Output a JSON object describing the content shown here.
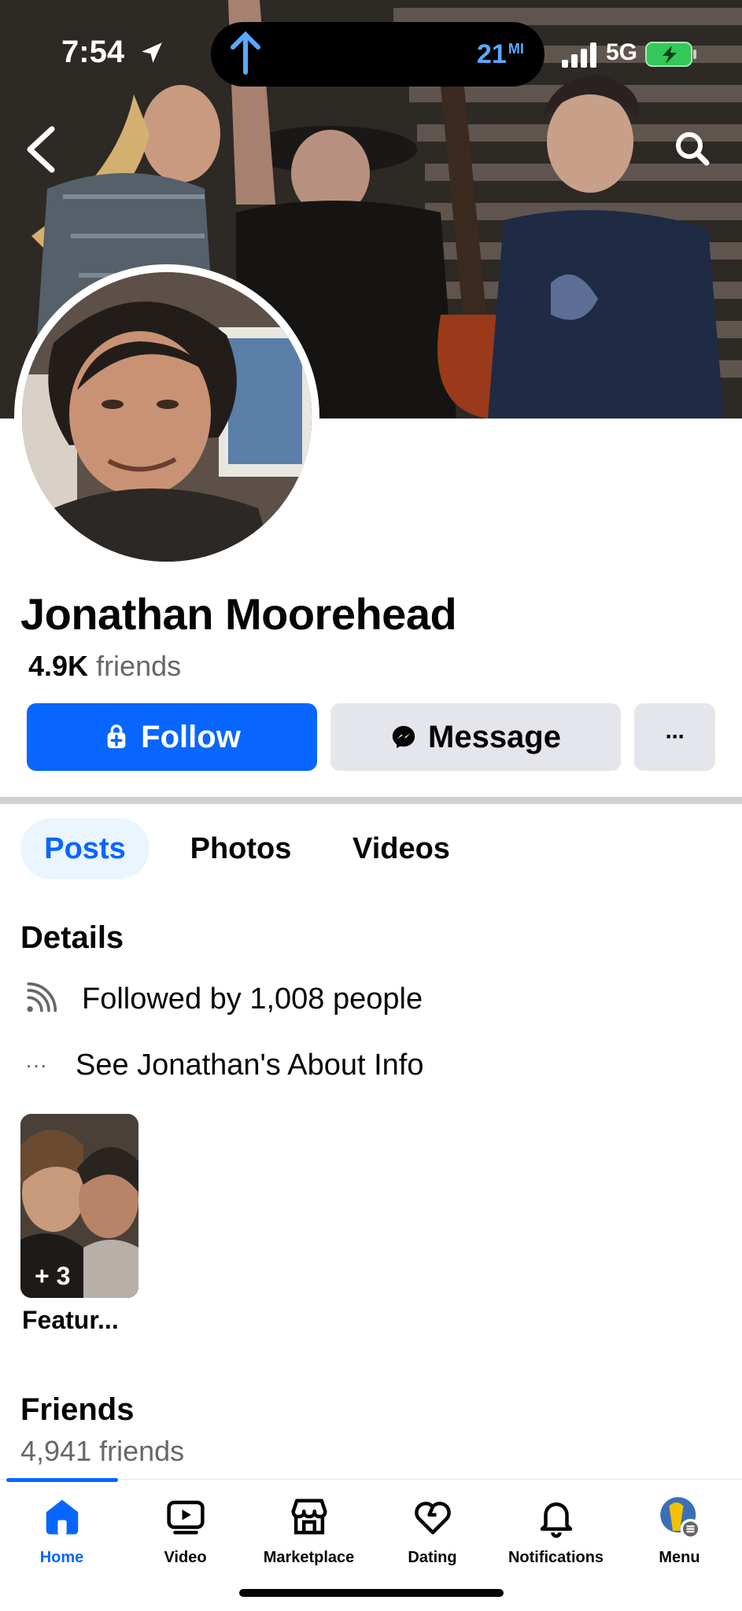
{
  "status_bar": {
    "time": "7:54",
    "navigation_distance": "21",
    "distance_unit": "MI",
    "network": "5G",
    "icons": [
      "location-arrow-icon",
      "navigation-up-arrow-icon",
      "signal-bars-icon",
      "battery-charging-icon"
    ]
  },
  "cover": {
    "back_icon": "chevron-left-icon",
    "search_icon": "search-icon"
  },
  "profile": {
    "name": "Jonathan Moorehead",
    "friends_short": "4.9K",
    "friends_word": "friends"
  },
  "actions": {
    "follow_label": "Follow",
    "message_label": "Message",
    "more_label": "···",
    "accent_color": "#0866ff"
  },
  "tabs": [
    {
      "label": "Posts",
      "active": true
    },
    {
      "label": "Photos",
      "active": false
    },
    {
      "label": "Videos",
      "active": false
    }
  ],
  "details": {
    "title": "Details",
    "followed_by": "Followed by 1,008 people",
    "about_info": "See Jonathan's About Info",
    "more_dots": "···"
  },
  "featured": {
    "count": "+ 3",
    "label": "Featur..."
  },
  "friends_section": {
    "title": "Friends",
    "count": "4,941 friends"
  },
  "bottom_nav": [
    {
      "label": "Home",
      "icon": "home-icon",
      "active": true
    },
    {
      "label": "Video",
      "icon": "video-icon",
      "active": false
    },
    {
      "label": "Marketplace",
      "icon": "marketplace-icon",
      "active": false
    },
    {
      "label": "Dating",
      "icon": "dating-icon",
      "active": false
    },
    {
      "label": "Notifications",
      "icon": "bell-icon",
      "active": false
    },
    {
      "label": "Menu",
      "icon": "menu-avatar-icon",
      "active": false
    }
  ]
}
